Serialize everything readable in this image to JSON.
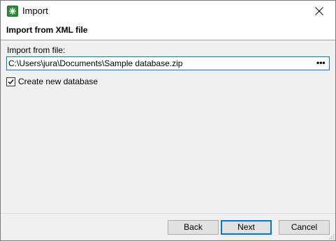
{
  "window": {
    "title": "Import",
    "close_icon": "close-icon",
    "app_icon": "app-snowflake-icon"
  },
  "header": {
    "title": "Import from XML file"
  },
  "form": {
    "file_label": "Import from file:",
    "file_path": "C:\\Users\\jura\\Documents\\Sample database.zip",
    "browse_label": "•••",
    "create_new_label": "Create new database",
    "create_new_checked": true
  },
  "buttons": {
    "back": "Back",
    "next": "Next",
    "cancel": "Cancel"
  },
  "colors": {
    "accent": "#0078d7",
    "app_icon": "#2e8b3a",
    "dialog_bg": "#f0f0f0"
  }
}
